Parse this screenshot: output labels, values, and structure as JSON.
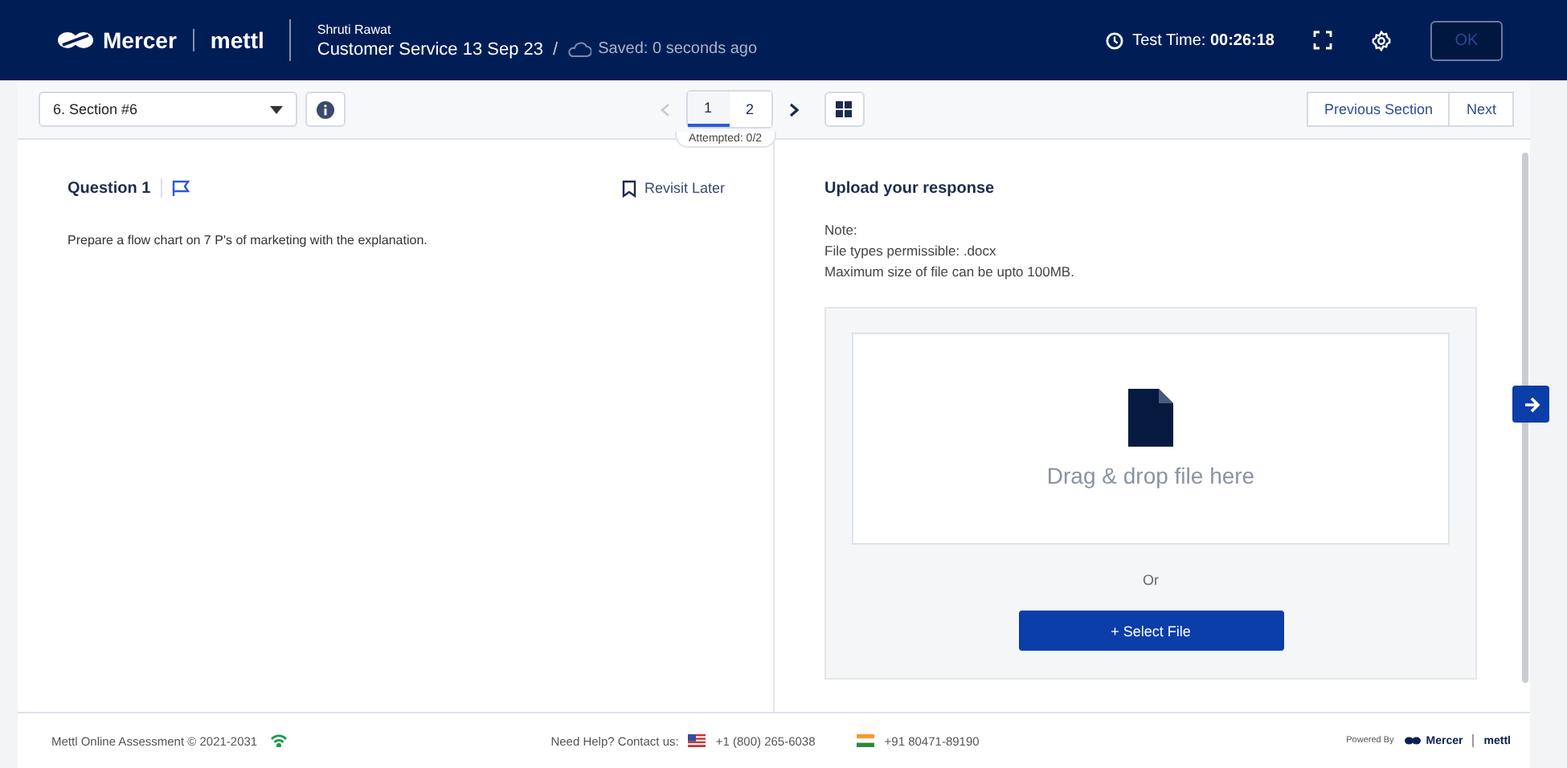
{
  "header": {
    "brand": "Mercer",
    "product": "mettl",
    "candidate": "Shruti Rawat",
    "test_name": "Customer Service 13 Sep 23",
    "separator": "/",
    "save_status": "Saved: 0 seconds ago",
    "timer_label": "Test Time:",
    "timer_value": "00:26:18",
    "ok_button": "OK"
  },
  "toolbar": {
    "section": "6. Section #6",
    "pages": [
      {
        "label": "1",
        "selected": true
      },
      {
        "label": "2",
        "selected": false
      }
    ],
    "attempted": "Attempted: 0/2",
    "prev_section": "Previous Section",
    "next": "Next"
  },
  "question": {
    "title": "Question 1",
    "revisit": "Revisit Later",
    "text": "Prepare a flow chart on 7 P's of marketing with the explanation."
  },
  "upload": {
    "title": "Upload your response",
    "notes": [
      "Note:",
      "File types permissible: .docx",
      "Maximum size of file can be upto 100MB."
    ],
    "drop_text": "Drag & drop file here",
    "or": "Or",
    "select_button": "+ Select File"
  },
  "footer": {
    "copyright": "Mettl Online Assessment © 2021-2031",
    "help": "Need Help? Contact us:",
    "phones": [
      {
        "kind": "us",
        "number": "+1 (800) 265-6038"
      },
      {
        "kind": "in",
        "number": "+91 80471-89190"
      }
    ],
    "powered_by": "Powered By",
    "brand": "Mercer",
    "product": "mettl"
  }
}
